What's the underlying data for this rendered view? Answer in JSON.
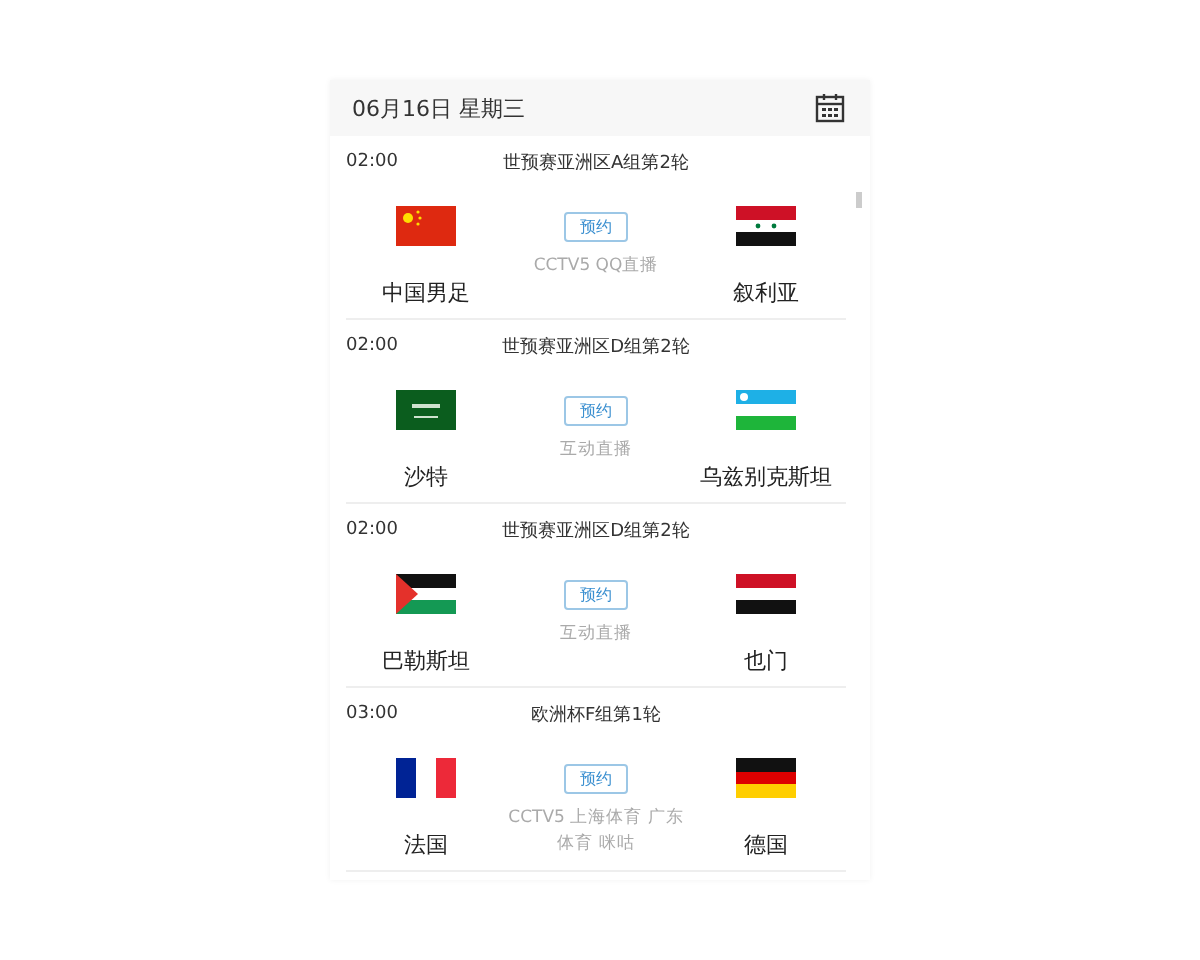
{
  "header": {
    "date": "06月16日 星期三"
  },
  "matches": [
    {
      "time": "02:00",
      "competition": "世预赛亚洲区A组第2轮",
      "home": {
        "name": "中国男足",
        "kind": "cn"
      },
      "away": {
        "name": "叙利亚",
        "kind": "sy"
      },
      "button": "预约",
      "broadcast": "CCTV5 QQ直播"
    },
    {
      "time": "02:00",
      "competition": "世预赛亚洲区D组第2轮",
      "home": {
        "name": "沙特",
        "kind": "sa"
      },
      "away": {
        "name": "乌兹别克斯坦",
        "kind": "uz"
      },
      "button": "预约",
      "broadcast": "互动直播"
    },
    {
      "time": "02:00",
      "competition": "世预赛亚洲区D组第2轮",
      "home": {
        "name": "巴勒斯坦",
        "kind": "ps"
      },
      "away": {
        "name": "也门",
        "kind": "ye"
      },
      "button": "预约",
      "broadcast": "互动直播"
    },
    {
      "time": "03:00",
      "competition": "欧洲杯F组第1轮",
      "home": {
        "name": "法国",
        "kind": "fr"
      },
      "away": {
        "name": "德国",
        "kind": "de"
      },
      "button": "预约",
      "broadcast": "CCTV5 上海体育 广东体育 咪咕"
    }
  ]
}
